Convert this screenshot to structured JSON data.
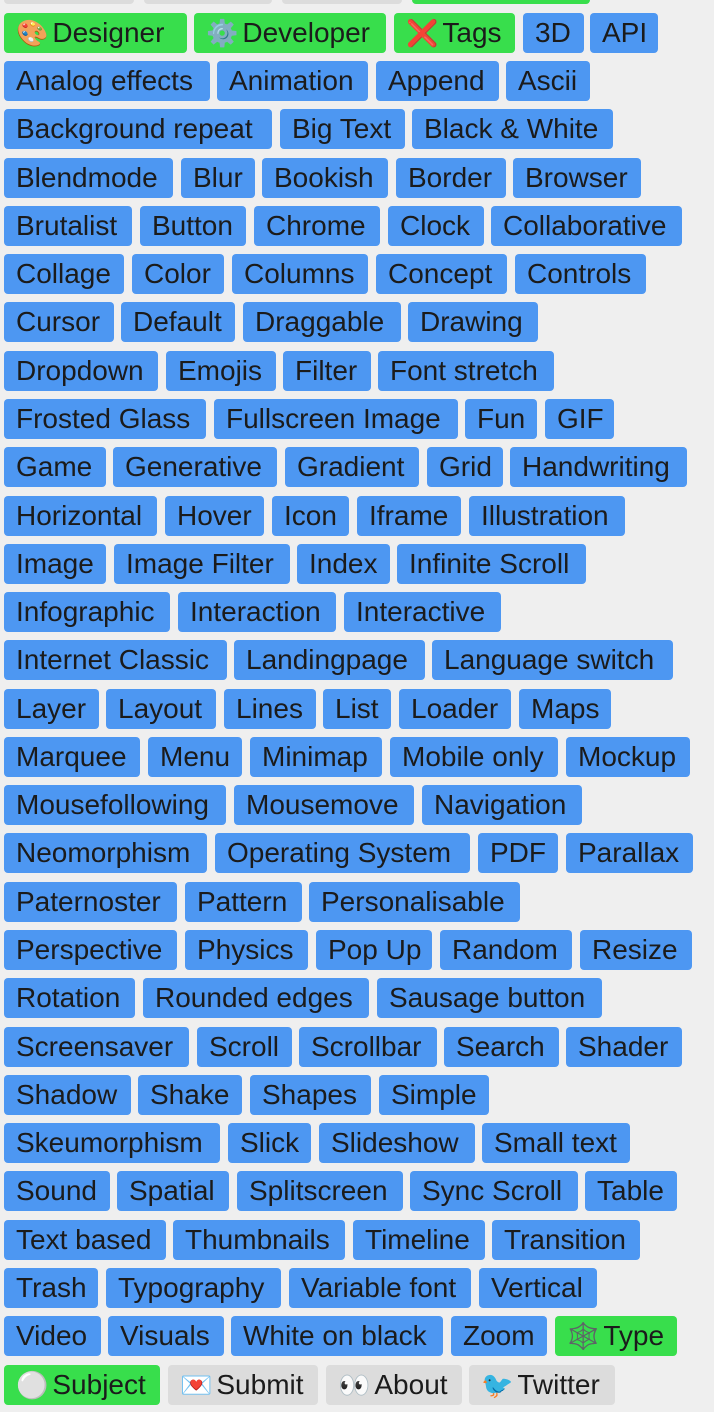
{
  "top_bar": {
    "designer": {
      "icon": "🎨",
      "label": "Designer"
    },
    "developer": {
      "icon": "⚙️",
      "label": "Developer"
    },
    "tags": {
      "icon": "❌",
      "label": "Tags"
    }
  },
  "tags": {
    "row1": [
      "3D",
      "API"
    ],
    "row2": [
      "Analog effects",
      "Animation",
      "Append",
      "Ascii"
    ],
    "row3": [
      "Background repeat",
      "Big Text",
      "Black & White"
    ],
    "row4": [
      "Blendmode",
      "Blur",
      "Bookish",
      "Border",
      "Browser"
    ],
    "row5": [
      "Brutalist",
      "Button",
      "Chrome",
      "Clock",
      "Collaborative"
    ],
    "row6": [
      "Collage",
      "Color",
      "Columns",
      "Concept",
      "Controls"
    ],
    "row7": [
      "Cursor",
      "Default",
      "Draggable",
      "Drawing"
    ],
    "row8": [
      "Dropdown",
      "Emojis",
      "Filter",
      "Font stretch"
    ],
    "row9": [
      "Frosted Glass",
      "Fullscreen Image",
      "Fun",
      "GIF"
    ],
    "row10": [
      "Game",
      "Generative",
      "Gradient",
      "Grid",
      "Handwriting"
    ],
    "row11": [
      "Horizontal",
      "Hover",
      "Icon",
      "Iframe",
      "Illustration"
    ],
    "row12": [
      "Image",
      "Image Filter",
      "Index",
      "Infinite Scroll"
    ],
    "row13": [
      "Infographic",
      "Interaction",
      "Interactive"
    ],
    "row14": [
      "Internet Classic",
      "Landingpage",
      "Language switch"
    ],
    "row15": [
      "Layer",
      "Layout",
      "Lines",
      "List",
      "Loader",
      "Maps"
    ],
    "row16": [
      "Marquee",
      "Menu",
      "Minimap",
      "Mobile only",
      "Mockup"
    ],
    "row17": [
      "Mousefollowing",
      "Mousemove",
      "Navigation"
    ],
    "row18": [
      "Neomorphism",
      "Operating System",
      "PDF",
      "Parallax"
    ],
    "row19": [
      "Paternoster",
      "Pattern",
      "Personalisable"
    ],
    "row20": [
      "Perspective",
      "Physics",
      "Pop Up",
      "Random",
      "Resize"
    ],
    "row21": [
      "Rotation",
      "Rounded edges",
      "Sausage button"
    ],
    "row22": [
      "Screensaver",
      "Scroll",
      "Scrollbar",
      "Search",
      "Shader"
    ],
    "row23": [
      "Shadow",
      "Shake",
      "Shapes",
      "Simple"
    ],
    "row24": [
      "Skeumorphism",
      "Slick",
      "Slideshow",
      "Small text"
    ],
    "row25": [
      "Sound",
      "Spatial",
      "Splitscreen",
      "Sync Scroll",
      "Table"
    ],
    "row26": [
      "Text based",
      "Thumbnails",
      "Timeline",
      "Transition"
    ],
    "row27": [
      "Trash",
      "Typography",
      "Variable font",
      "Vertical"
    ],
    "row28": [
      "Video",
      "Visuals",
      "White on black",
      "Zoom"
    ]
  },
  "type_button": {
    "icon": "🕸️",
    "label": "Type"
  },
  "bottom_bar": {
    "subject": {
      "icon": "⚪",
      "label": "Subject"
    },
    "submit": {
      "icon": "💌",
      "label": "Submit"
    },
    "about": {
      "icon": "👀",
      "label": "About"
    },
    "twitter": {
      "icon": "🐦",
      "label": "Twitter"
    }
  },
  "colors": {
    "tag_blue": "#4d97f2",
    "active_green": "#38de4c",
    "neutral_gray": "#dcdcdc",
    "page_background": "#efefef"
  }
}
